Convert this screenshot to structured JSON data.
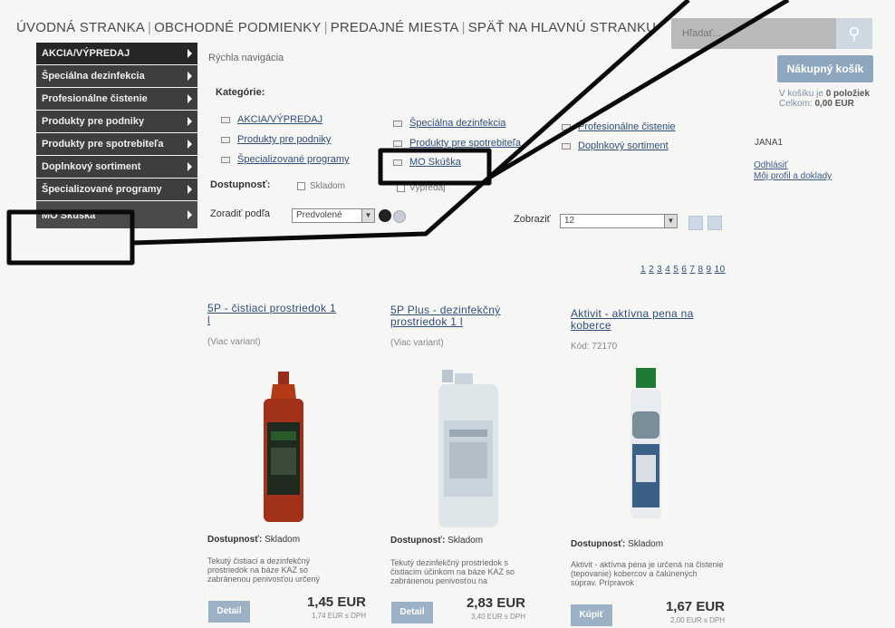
{
  "topnav": {
    "home": "ÚVODNÁ STRANKA",
    "terms": "OBCHODNÉ PODMIENKY",
    "stores": "PREDAJNÉ MIESTA",
    "back": "SPÄŤ NA HLAVNÚ STRANKU",
    "separator": "|"
  },
  "search": {
    "placeholder": "Hľadať...",
    "icon": "search-icon"
  },
  "sidebar": {
    "items": [
      {
        "label": "AKCIA/VÝPREDAJ"
      },
      {
        "label": "Špeciálna dezinfekcia"
      },
      {
        "label": "Profesionálne čistenie"
      },
      {
        "label": "Produkty pre podniky"
      },
      {
        "label": "Produkty pre spotrebiteľa"
      },
      {
        "label": "Doplnkový sortiment"
      },
      {
        "label": "Špecializované programy"
      },
      {
        "label": "MO Skúška"
      }
    ]
  },
  "breadcrumb": "Rýchla navigácia",
  "categories": {
    "title": "Kategórie:",
    "items": [
      "AKCIA/VÝPREDAJ",
      "Špeciálna dezinfekcia",
      "Profesionálne čistenie",
      "Produkty pre podniky",
      "Produkty pre spotrebiteľa",
      "Doplnkový sortiment",
      "Špecializované programy",
      "MO Skúška"
    ]
  },
  "filters": {
    "availability_label": "Dostupnosť:",
    "in_stock": "Skladom",
    "sale": "Výpredaj",
    "sort_label": "Zoradiť podľa",
    "sort_value": "Predvolené",
    "show_label": "Zobraziť",
    "show_value": "12"
  },
  "cart": {
    "button": "Nákupný košík",
    "line1_prefix": "V košíku je",
    "line1_count": "0 položiek",
    "line2_prefix": "Celkom:",
    "line2_total": "0,00 EUR"
  },
  "user": {
    "name": "JANA1",
    "logout": "Odhlásiť",
    "profile": "Môj profil a doklady"
  },
  "pager": [
    "1",
    "2",
    "3",
    "4",
    "5",
    "6",
    "7",
    "8",
    "9",
    "10"
  ],
  "products": [
    {
      "title_l1": "5P - čistiaci prostriedok 1",
      "title_l2": "l",
      "sub": "(Viac variant)",
      "avail_label": "Dostupnosť:",
      "avail_value": "Skladom",
      "desc": "Tekutý čistiaci a dezinfekčný prostriedok na báze KAZ so zabránenou penivosťou určený",
      "price": "1,45 EUR",
      "price_vat": "1,74 EUR s DPH",
      "button": "Detail"
    },
    {
      "title_l1": "5P Plus - dezinfekčný",
      "title_l2": "prostriedok 1 l",
      "sub": "(Viac variant)",
      "avail_label": "Dostupnosť:",
      "avail_value": "Skladom",
      "desc": "Tekutý dezinfekčný prostriedok s čistiacim účinkom na báze KAZ so zabránenou penivosťou na",
      "price": "2,83 EUR",
      "price_vat": "3,40 EUR s DPH",
      "button": "Detail"
    },
    {
      "title_l1": "Aktivit - aktívna pena na",
      "title_l2": "koberce",
      "sub": "Kód: 72170",
      "avail_label": "Dostupnosť:",
      "avail_value": "Skladom",
      "desc": "Aktivit - aktívna pena je určená na čistenie (tepovanie) kobercov a čalúnených súprav. Prípravok",
      "price": "1,67 EUR",
      "price_vat": "2,00 EUR s DPH",
      "button": "Kúpiť"
    }
  ],
  "colors": {
    "sidebar_bg": "#3e3e3e",
    "link": "#2d4e7e",
    "cart_button": "#8fa6bf",
    "annotation": "#0a0a0a"
  }
}
